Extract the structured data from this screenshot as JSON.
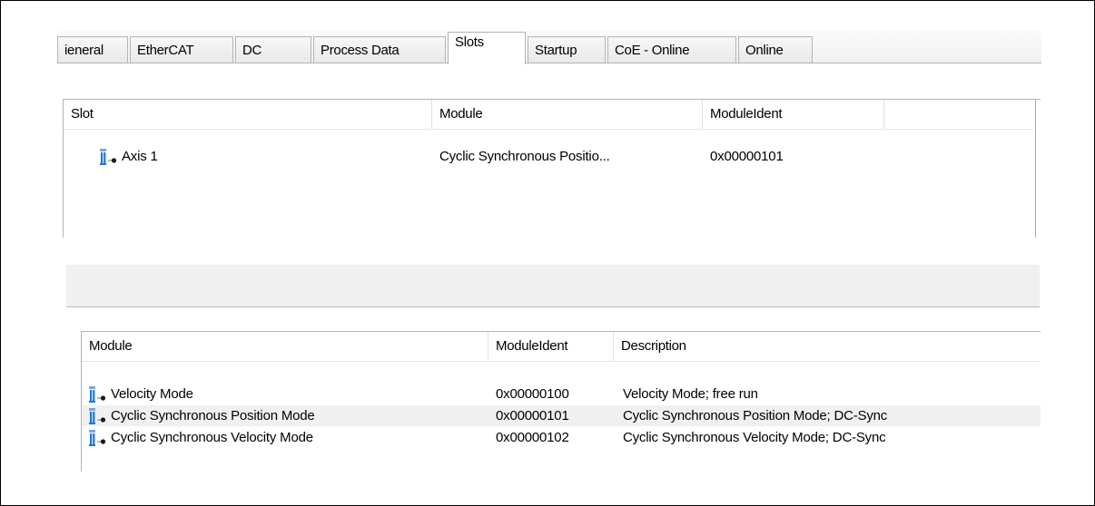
{
  "tabs": [
    {
      "label": "ieneral",
      "active": false
    },
    {
      "label": "EtherCAT",
      "active": false
    },
    {
      "label": "DC",
      "active": false
    },
    {
      "label": "Process Data",
      "active": false
    },
    {
      "label": "Slots",
      "active": true
    },
    {
      "label": "Startup",
      "active": false
    },
    {
      "label": "CoE - Online",
      "active": false
    },
    {
      "label": "Online",
      "active": false
    }
  ],
  "slots_table": {
    "columns": [
      "Slot",
      "Module",
      "ModuleIdent"
    ],
    "rows": [
      {
        "slot": "Axis 1",
        "module": "Cyclic Synchronous Positio...",
        "ident": "0x00000101",
        "icon": "module-icon"
      }
    ]
  },
  "modules_table": {
    "columns": [
      "Module",
      "ModuleIdent",
      "Description"
    ],
    "rows": [
      {
        "module": "Velocity Mode",
        "ident": "0x00000100",
        "description": "Velocity Mode; free run",
        "selected": false,
        "icon": "module-icon"
      },
      {
        "module": "Cyclic Synchronous Position Mode",
        "ident": "0x00000101",
        "description": "Cyclic Synchronous Position Mode; DC-Sync",
        "selected": true,
        "icon": "module-icon"
      },
      {
        "module": "Cyclic Synchronous Velocity Mode",
        "ident": "0x00000102",
        "description": "Cyclic Synchronous Velocity Mode; DC-Sync",
        "selected": false,
        "icon": "module-icon"
      }
    ]
  },
  "colors": {
    "icon_blue": "#1e78d7",
    "selected_row": "#f0f0f0",
    "border": "#b4b4b4"
  }
}
